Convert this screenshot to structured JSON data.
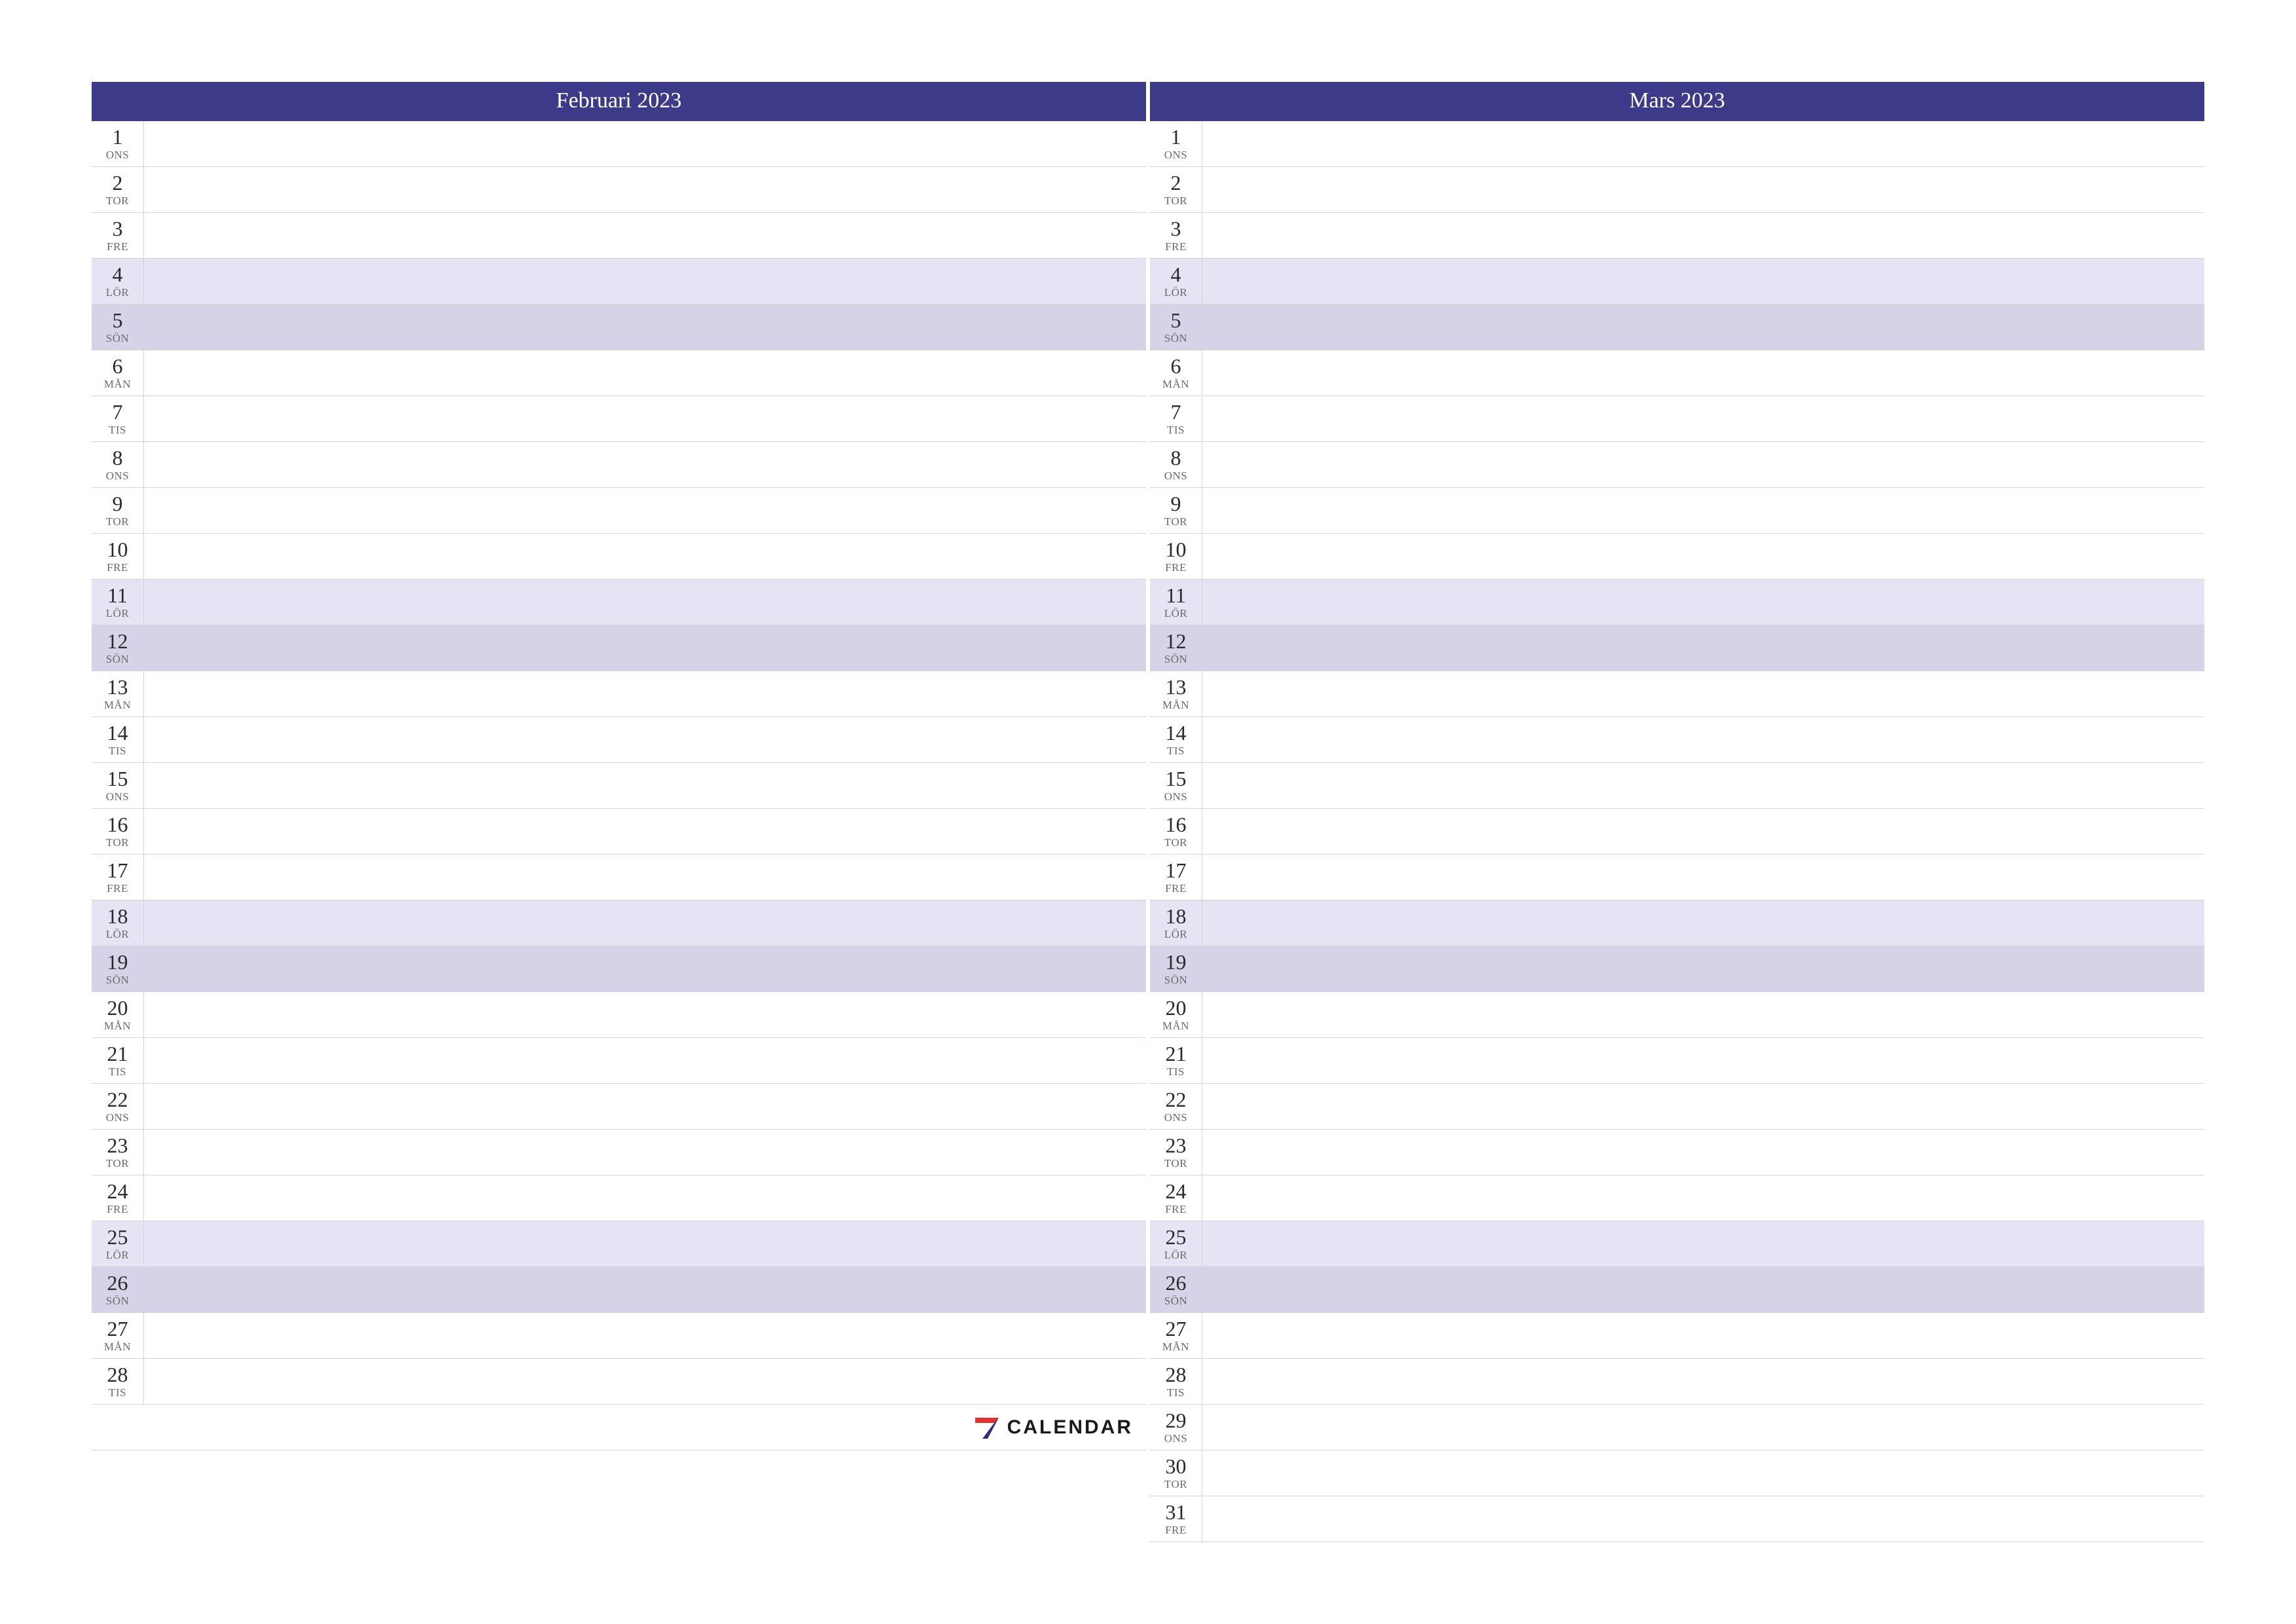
{
  "brand": {
    "text": "CALENDAR"
  },
  "weekday_labels": [
    "MÅN",
    "TIS",
    "ONS",
    "TOR",
    "FRE",
    "LÖR",
    "SÖN"
  ],
  "months": [
    {
      "title": "Februari 2023",
      "days": [
        {
          "num": 1,
          "wd": 2
        },
        {
          "num": 2,
          "wd": 3
        },
        {
          "num": 3,
          "wd": 4
        },
        {
          "num": 4,
          "wd": 5
        },
        {
          "num": 5,
          "wd": 6
        },
        {
          "num": 6,
          "wd": 0
        },
        {
          "num": 7,
          "wd": 1
        },
        {
          "num": 8,
          "wd": 2
        },
        {
          "num": 9,
          "wd": 3
        },
        {
          "num": 10,
          "wd": 4
        },
        {
          "num": 11,
          "wd": 5
        },
        {
          "num": 12,
          "wd": 6
        },
        {
          "num": 13,
          "wd": 0
        },
        {
          "num": 14,
          "wd": 1
        },
        {
          "num": 15,
          "wd": 2
        },
        {
          "num": 16,
          "wd": 3
        },
        {
          "num": 17,
          "wd": 4
        },
        {
          "num": 18,
          "wd": 5
        },
        {
          "num": 19,
          "wd": 6
        },
        {
          "num": 20,
          "wd": 0
        },
        {
          "num": 21,
          "wd": 1
        },
        {
          "num": 22,
          "wd": 2
        },
        {
          "num": 23,
          "wd": 3
        },
        {
          "num": 24,
          "wd": 4
        },
        {
          "num": 25,
          "wd": 5
        },
        {
          "num": 26,
          "wd": 6
        },
        {
          "num": 27,
          "wd": 0
        },
        {
          "num": 28,
          "wd": 1
        }
      ]
    },
    {
      "title": "Mars 2023",
      "days": [
        {
          "num": 1,
          "wd": 2
        },
        {
          "num": 2,
          "wd": 3
        },
        {
          "num": 3,
          "wd": 4
        },
        {
          "num": 4,
          "wd": 5
        },
        {
          "num": 5,
          "wd": 6
        },
        {
          "num": 6,
          "wd": 0
        },
        {
          "num": 7,
          "wd": 1
        },
        {
          "num": 8,
          "wd": 2
        },
        {
          "num": 9,
          "wd": 3
        },
        {
          "num": 10,
          "wd": 4
        },
        {
          "num": 11,
          "wd": 5
        },
        {
          "num": 12,
          "wd": 6
        },
        {
          "num": 13,
          "wd": 0
        },
        {
          "num": 14,
          "wd": 1
        },
        {
          "num": 15,
          "wd": 2
        },
        {
          "num": 16,
          "wd": 3
        },
        {
          "num": 17,
          "wd": 4
        },
        {
          "num": 18,
          "wd": 5
        },
        {
          "num": 19,
          "wd": 6
        },
        {
          "num": 20,
          "wd": 0
        },
        {
          "num": 21,
          "wd": 1
        },
        {
          "num": 22,
          "wd": 2
        },
        {
          "num": 23,
          "wd": 3
        },
        {
          "num": 24,
          "wd": 4
        },
        {
          "num": 25,
          "wd": 5
        },
        {
          "num": 26,
          "wd": 6
        },
        {
          "num": 27,
          "wd": 0
        },
        {
          "num": 28,
          "wd": 1
        },
        {
          "num": 29,
          "wd": 2
        },
        {
          "num": 30,
          "wd": 3
        },
        {
          "num": 31,
          "wd": 4
        }
      ]
    }
  ]
}
